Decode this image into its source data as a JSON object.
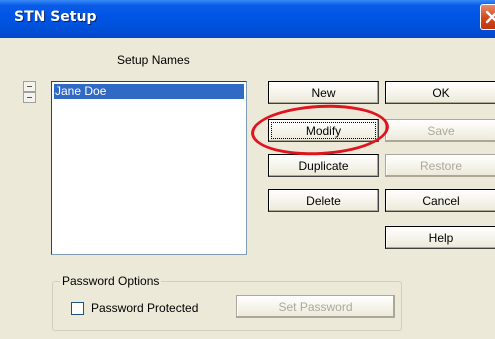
{
  "window": {
    "title": "STN Setup",
    "close_icon": "close-icon"
  },
  "setup_names": {
    "label": "Setup Names",
    "items": [
      "Jane Doe"
    ],
    "selected_index": 0
  },
  "buttons": {
    "new": "New",
    "modify": "Modify",
    "duplicate": "Duplicate",
    "delete": "Delete",
    "ok": "OK",
    "save": "Save",
    "restore": "Restore",
    "cancel": "Cancel",
    "help": "Help"
  },
  "disabled_buttons": [
    "Save",
    "Restore",
    "Set Password"
  ],
  "password_options": {
    "legend": "Password Options",
    "checkbox_label": "Password Protected",
    "checked": false,
    "set_password_button": "Set Password"
  },
  "annotation": {
    "highlight_target": "Modify",
    "color": "#e0141e"
  },
  "colors": {
    "titlebar": "#0055e5",
    "dialog_background": "#ece9d8",
    "selection": "#316ac5"
  }
}
